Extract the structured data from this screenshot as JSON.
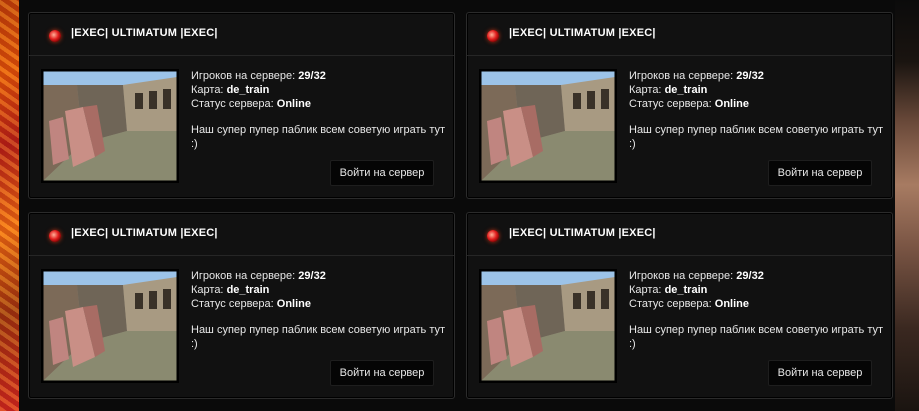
{
  "servers": [
    {
      "name": "|EXEC| ULTIMATUM |EXEC|",
      "players_label": "Игроков на сервере:",
      "players_value": "29/32",
      "map_label": "Карта:",
      "map_value": "de_train",
      "status_label": "Статус сервера:",
      "status_value": "Online",
      "description": "Наш супер пупер паблик всем советую играть тут :)",
      "join_label": "Войти на сервер"
    },
    {
      "name": "|EXEC| ULTIMATUM |EXEC|",
      "players_label": "Игроков на сервере:",
      "players_value": "29/32",
      "map_label": "Карта:",
      "map_value": "de_train",
      "status_label": "Статус сервера:",
      "status_value": "Online",
      "description": "Наш супер пупер паблик всем советую играть тут :)",
      "join_label": "Войти на сервер"
    },
    {
      "name": "|EXEC| ULTIMATUM |EXEC|",
      "players_label": "Игроков на сервере:",
      "players_value": "29/32",
      "map_label": "Карта:",
      "map_value": "de_train",
      "status_label": "Статус сервера:",
      "status_value": "Online",
      "description": "Наш супер пупер паблик всем советую играть тут :)",
      "join_label": "Войти на сервер"
    },
    {
      "name": "|EXEC| ULTIMATUM |EXEC|",
      "players_label": "Игроков на сервере:",
      "players_value": "29/32",
      "map_label": "Карта:",
      "map_value": "de_train",
      "status_label": "Статус сервера:",
      "status_value": "Online",
      "description": "Наш супер пупер паблик всем советую играть тут :)",
      "join_label": "Войти на сервер"
    }
  ],
  "colors": {
    "card_bg": "#111111",
    "card_border": "#2b2b2b",
    "text": "#e8e8e8",
    "status_icon": "#e11d1d"
  },
  "icons": {
    "server": "server-status-icon",
    "map": "map-thumbnail"
  }
}
